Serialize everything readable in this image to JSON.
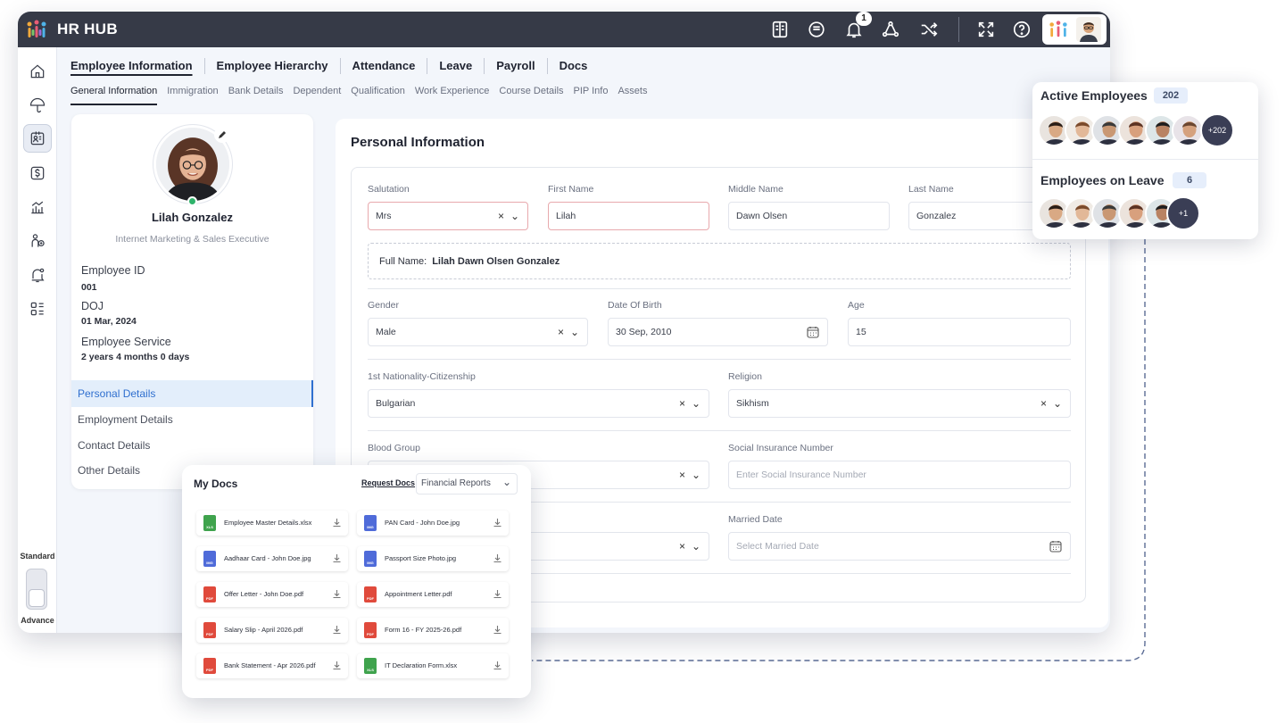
{
  "app": {
    "name": "HR HUB",
    "notification_count": "1"
  },
  "sidebar": {
    "mode_top": "Standard",
    "mode_bottom": "Advance"
  },
  "main_nav": [
    "Employee Information",
    "Employee Hierarchy",
    "Attendance",
    "Leave",
    "Payroll",
    "Docs"
  ],
  "sub_nav": [
    "General Information",
    "Immigration",
    "Bank Details",
    "Dependent",
    "Qualification",
    "Work Experience",
    "Course Details",
    "PIP Info",
    "Assets"
  ],
  "profile": {
    "name": "Lilah Gonzalez",
    "title": "Internet Marketing & Sales Executive",
    "employee_id_label": "Employee ID",
    "employee_id": "001",
    "doj_label": "DOJ",
    "doj": "01 Mar, 2024",
    "service_label": "Employee Service",
    "service": "2 years 4 months 0 days",
    "menu": [
      "Personal Details",
      "Employment Details",
      "Contact Details",
      "Other Details"
    ]
  },
  "personal_info": {
    "title": "Personal Information",
    "salutation_label": "Salutation",
    "salutation": "Mrs",
    "first_name_label": "First Name",
    "first_name": "Lilah",
    "middle_name_label": "Middle Name",
    "middle_name": "Dawn Olsen",
    "last_name_label": "Last Name",
    "last_name": "Gonzalez",
    "full_name_label": "Full Name:",
    "full_name": "Lilah Dawn Olsen Gonzalez",
    "gender_label": "Gender",
    "gender": "Male",
    "dob_label": "Date Of Birth",
    "dob": "30 Sep, 2010",
    "age_label": "Age",
    "age": "15",
    "nationality_label": "1st Nationality-Citizenship",
    "nationality": "Bulgarian",
    "religion_label": "Religion",
    "religion": "Sikhism",
    "blood_group_label": "Blood Group",
    "sin_label": "Social Insurance Number",
    "sin_placeholder": "Enter Social Insurance Number",
    "married_date_label": "Married Date",
    "married_date_placeholder": "Select Married Date",
    "clear_symbol": "×"
  },
  "active_employees": {
    "title": "Active Employees",
    "count": "202",
    "more": "+202"
  },
  "on_leave": {
    "title": "Employees on Leave",
    "count": "6",
    "more": "+1"
  },
  "my_docs": {
    "title": "My Docs",
    "request": "Request Docs",
    "filter": "Financial Reports",
    "files": [
      {
        "name": "Employee Master Details.xlsx",
        "type": "XLS",
        "color": "#3fa34d"
      },
      {
        "name": "PAN Card - John Doe.jpg",
        "type": "IMG",
        "color": "#4f6bd9"
      },
      {
        "name": "Aadhaar Card - John Doe.jpg",
        "type": "IMG",
        "color": "#4f6bd9"
      },
      {
        "name": "Passport Size Photo.jpg",
        "type": "IMG",
        "color": "#4f6bd9"
      },
      {
        "name": "Offer Letter - John Doe.pdf",
        "type": "PDF",
        "color": "#e04a3c"
      },
      {
        "name": "Appointment Letter.pdf",
        "type": "PDF",
        "color": "#e04a3c"
      },
      {
        "name": "Salary Slip - April 2026.pdf",
        "type": "PDF",
        "color": "#e04a3c"
      },
      {
        "name": "Form 16 - FY 2025-26.pdf",
        "type": "PDF",
        "color": "#e04a3c"
      },
      {
        "name": "Bank Statement - Apr 2026.pdf",
        "type": "PDF",
        "color": "#e04a3c"
      },
      {
        "name": "IT Declaration Form.xlsx",
        "type": "XLS",
        "color": "#3fa34d"
      }
    ]
  },
  "colors": {
    "accent": "#2f6fcf",
    "topbar": "#363a47",
    "online": "#2fb36b"
  }
}
